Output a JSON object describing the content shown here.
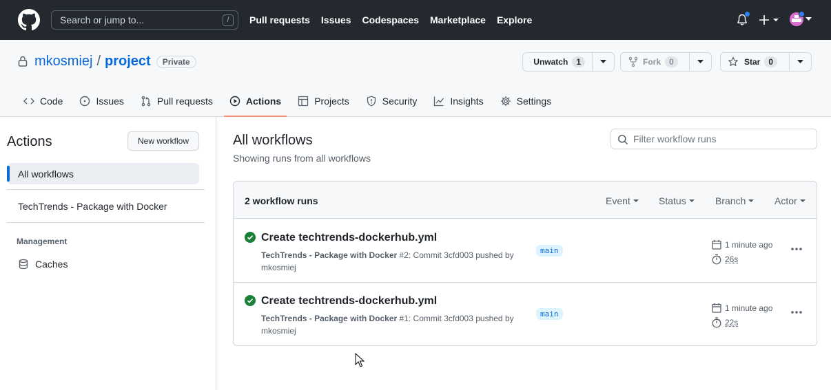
{
  "header": {
    "search_placeholder": "Search or jump to...",
    "search_shortcut": "/",
    "nav": [
      "Pull requests",
      "Issues",
      "Codespaces",
      "Marketplace",
      "Explore"
    ]
  },
  "repo": {
    "owner": "mkosmiej",
    "separator": "/",
    "name": "project",
    "visibility": "Private",
    "unwatch_label": "Unwatch",
    "watch_count": "1",
    "fork_label": "Fork",
    "fork_count": "0",
    "star_label": "Star",
    "star_count": "0"
  },
  "tabs": [
    {
      "label": "Code",
      "icon": "code-icon"
    },
    {
      "label": "Issues",
      "icon": "issue-icon"
    },
    {
      "label": "Pull requests",
      "icon": "pull-request-icon"
    },
    {
      "label": "Actions",
      "icon": "play-icon",
      "active": true
    },
    {
      "label": "Projects",
      "icon": "table-icon"
    },
    {
      "label": "Security",
      "icon": "shield-icon"
    },
    {
      "label": "Insights",
      "icon": "graph-icon"
    },
    {
      "label": "Settings",
      "icon": "gear-icon"
    }
  ],
  "sidebar": {
    "title": "Actions",
    "new_workflow": "New workflow",
    "all_workflows": "All workflows",
    "workflow": "TechTrends - Package with Docker",
    "management_heading": "Management",
    "caches": "Caches"
  },
  "main": {
    "title": "All workflows",
    "subtitle": "Showing runs from all workflows",
    "filter_placeholder": "Filter workflow runs",
    "runs_count": "2 workflow runs",
    "filters": [
      "Event",
      "Status",
      "Branch",
      "Actor"
    ]
  },
  "runs": [
    {
      "title": "Create techtrends-dockerhub.yml",
      "workflow": "TechTrends - Package with Docker",
      "meta_rest": " #2: Commit 3cfd003 pushed by",
      "actor": "mkosmiej",
      "branch": "main",
      "time": "1 minute ago",
      "duration": "26s"
    },
    {
      "title": "Create techtrends-dockerhub.yml",
      "workflow": "TechTrends - Package with Docker",
      "meta_rest": " #1: Commit 3cfd003 pushed by",
      "actor": "mkosmiej",
      "branch": "main",
      "time": "1 minute ago",
      "duration": "22s"
    }
  ],
  "colors": {
    "header_bg": "#24292f",
    "link": "#0969da",
    "success": "#1a7f37",
    "active_tab_underline": "#fd8c73"
  }
}
